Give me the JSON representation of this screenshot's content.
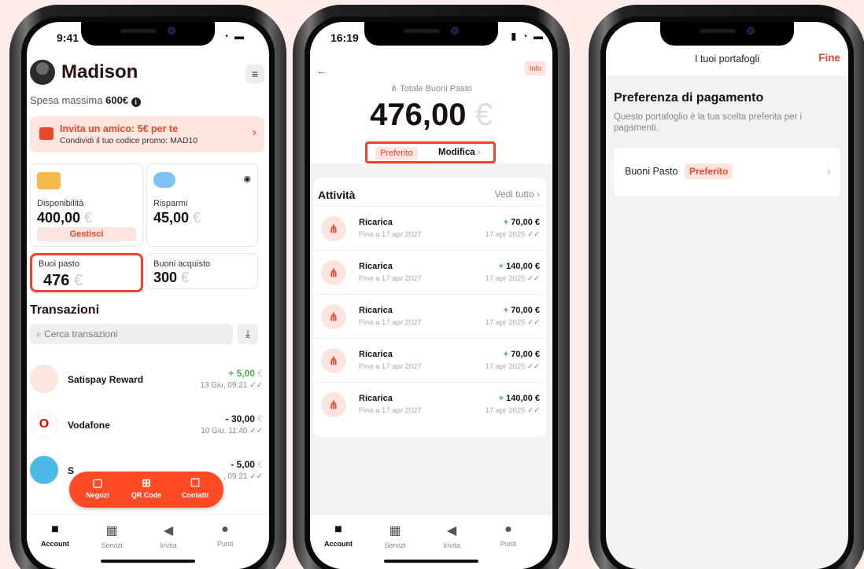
{
  "phone1": {
    "status_time": "9:41",
    "user_name": "Madison",
    "spesa_label": "Spesa massima",
    "spesa_value": "600€",
    "invite": {
      "title": "Invita un amico: 5€ per te",
      "subtitle": "Condividi il tuo codice promo: MAD10"
    },
    "disponibilita": {
      "label": "Disponibilità",
      "value": "400,00",
      "currency": "€",
      "action": "Gestisci"
    },
    "risparmi": {
      "label": "Risparmi",
      "value": "45,00",
      "currency": "€"
    },
    "buoi_pasto": {
      "label": "Buoi pasto",
      "value": "476",
      "currency": "€"
    },
    "buoni_acquisto": {
      "label": "Buoni acquisto",
      "value": "300",
      "currency": "€"
    },
    "transactions_title": "Transazioni",
    "search_placeholder": "Cerca transazioni",
    "transactions": [
      {
        "name": "Satispay Reward",
        "amount": "+ 5,00",
        "currency": "€",
        "date": "13 Giu, 09:21"
      },
      {
        "name": "Vodafone",
        "amount": "- 30,00",
        "currency": "€",
        "date": "10 Giu, 11:40"
      },
      {
        "name": "S",
        "amount": "- 5,00",
        "currency": "€",
        "date": ", 09:21"
      }
    ],
    "fab": [
      "Negozi",
      "QR Code",
      "Contatti"
    ],
    "tabs": [
      "Account",
      "Servizi",
      "Invita",
      "Punti"
    ]
  },
  "phone2": {
    "status_time": "16:19",
    "info": "Info",
    "totale_label": "Totale Buoni Pasto",
    "total": "476,00",
    "currency": "€",
    "preferito": "Preferito",
    "modifica": "Modifica",
    "attivita_title": "Attività",
    "vedi_tutto": "Vedi tutto",
    "activities": [
      {
        "title": "Ricarica",
        "sub": "Fino a 17 apr 2027",
        "amount": "70,00 €",
        "date": "17 apr 2025"
      },
      {
        "title": "Ricarica",
        "sub": "Fino a 17 apr 2027",
        "amount": "140,00 €",
        "date": "17 apr 2025"
      },
      {
        "title": "Ricarica",
        "sub": "Fino a 17 apr 2027",
        "amount": "70,00 €",
        "date": "17 apr 2025"
      },
      {
        "title": "Ricarica",
        "sub": "Fino a 17 apr 2027",
        "amount": "70,00 €",
        "date": "17 apr 2025"
      },
      {
        "title": "Ricarica",
        "sub": "Fino a 17 apr 2027",
        "amount": "140,00 €",
        "date": "17 apr 2025"
      }
    ],
    "tabs": [
      "Account",
      "Servizi",
      "Invita",
      "Punti"
    ]
  },
  "phone3": {
    "title": "I tuoi portafogli",
    "done": "Fine",
    "section_title": "Preferenza di pagamento",
    "description": "Questo portafoglio è la tua scelta preferita per i pagamenti.",
    "wallet_name": "Buoni Pasto",
    "wallet_badge": "Preferito"
  },
  "colors": {
    "accent": "#e8462a",
    "fab": "#ff4a25",
    "background": "#fdecea"
  }
}
